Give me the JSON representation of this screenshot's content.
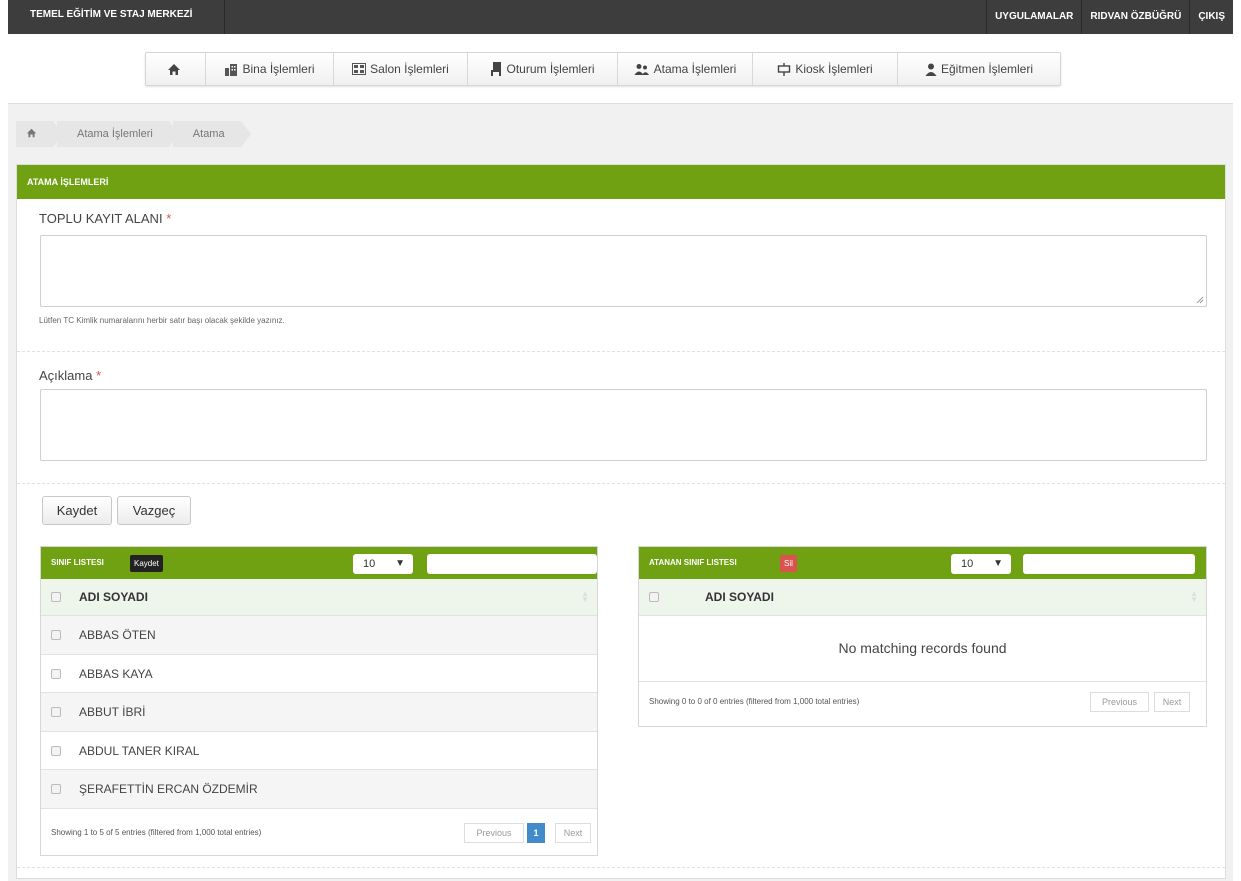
{
  "brand": "TEMEL EĞİTİM VE STAJ MERKEZİ",
  "top_links": [
    "UYGULAMALAR",
    "RIDVAN ÖZBÜĞRÜ",
    "ÇIKIŞ"
  ],
  "nav": {
    "items": [
      {
        "label": "",
        "icon": "home-icon"
      },
      {
        "label": "Bina İşlemleri",
        "icon": "building-icon"
      },
      {
        "label": "Salon İşlemleri",
        "icon": "hall-icon"
      },
      {
        "label": "Oturum İşlemleri",
        "icon": "chair-icon"
      },
      {
        "label": "Atama İşlemleri",
        "icon": "users-icon"
      },
      {
        "label": "Kiosk İşlemleri",
        "icon": "kiosk-icon"
      },
      {
        "label": "Eğitmen İşlemleri",
        "icon": "user-icon"
      }
    ]
  },
  "breadcrumb": [
    "Atama İşlemleri",
    "Atama"
  ],
  "panel": {
    "title": "ATAMA İŞLEMLERİ",
    "bulk_label": "TOPLU KAYIT ALANI",
    "required_mark": "*",
    "bulk_help": "Lütfen TC Kimlik numaralarını herbir satır başı olacak şekilde yazınız.",
    "desc_label": "Açıklama",
    "save_label": "Kaydet",
    "cancel_label": "Vazgeç"
  },
  "class_list": {
    "title": "SINIF LISTESI",
    "tag": "Kaydet",
    "page_size": "10",
    "column": "ADI SOYADI",
    "rows": [
      "ABBAS ÖTEN",
      "ABBAS KAYA",
      "ABBUT İBRİ",
      "ABDUL TANER KIRAL",
      "ŞERAFETTİN ERCAN ÖZDEMİR"
    ],
    "info": "Showing 1 to 5 of 5 entries (filtered from 1,000 total entries)",
    "prev": "Previous",
    "page": "1",
    "next": "Next"
  },
  "assigned_list": {
    "title": "ATANAN SINIF LISTESI",
    "tag": "Sil",
    "page_size": "10",
    "column": "ADI SOYADI",
    "empty": "No matching records found",
    "info": "Showing 0 to 0 of 0 entries (filtered from 1,000 total entries)",
    "prev": "Previous",
    "next": "Next"
  },
  "colors": {
    "accent": "#6fa112",
    "topbar": "#3d3d3d",
    "danger": "#d9534f",
    "page_active": "#428bca"
  }
}
